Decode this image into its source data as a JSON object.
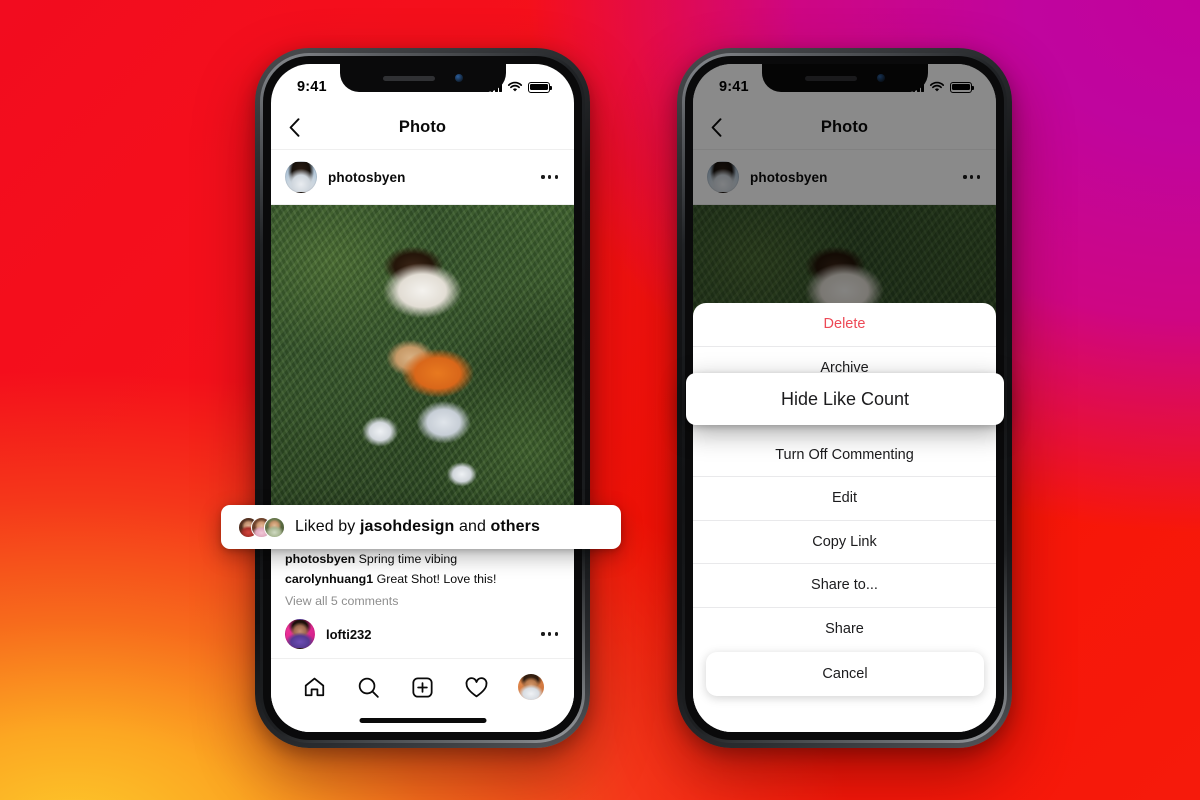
{
  "background": {
    "gradient_colors": [
      "#FDC82A",
      "#F76B1C",
      "#F20C1F",
      "#F81306",
      "#CE0683",
      "#C0059E"
    ]
  },
  "status_bar": {
    "time": "9:41"
  },
  "nav": {
    "title": "Photo",
    "back_icon": "chevron-left-icon"
  },
  "post": {
    "username": "photosbyen",
    "menu_icon": "more-options-icon",
    "actions": {
      "like_icon": "heart-icon",
      "comment_icon": "comment-bubble-icon",
      "share_icon": "share-paper-plane-icon",
      "save_icon": "bookmark-icon"
    },
    "caption": {
      "username": "photosbyen",
      "text": "Spring time vibing"
    },
    "comment": {
      "username": "carolynhuang1",
      "text": "Great Shot! Love this!"
    },
    "view_all_comments": "View all 5 comments",
    "comment_row": {
      "username": "lofti232",
      "menu_icon": "more-options-icon"
    }
  },
  "liked_card": {
    "prefix": "Liked by ",
    "username": "jasohdesign",
    "middle": " and ",
    "suffix": "others"
  },
  "tabbar": {
    "items": [
      {
        "icon": "home-icon",
        "label": "Home"
      },
      {
        "icon": "search-icon",
        "label": "Search"
      },
      {
        "icon": "add-post-icon",
        "label": "Create"
      },
      {
        "icon": "heart-icon",
        "label": "Activity"
      },
      {
        "icon": "profile-avatar-icon",
        "label": "Profile"
      }
    ]
  },
  "action_sheet": {
    "items": [
      {
        "label": "Delete",
        "style": "destructive"
      },
      {
        "label": "Archive",
        "style": "default"
      },
      {
        "label": "Hide Like Count",
        "style": "highlighted"
      },
      {
        "label": "Turn Off Commenting",
        "style": "default"
      },
      {
        "label": "Edit",
        "style": "default"
      },
      {
        "label": "Copy Link",
        "style": "default"
      },
      {
        "label": "Share to...",
        "style": "default"
      },
      {
        "label": "Share",
        "style": "default"
      }
    ],
    "cancel_label": "Cancel",
    "highlighted_label": "Hide Like Count",
    "destructive_color": "#ED4956"
  }
}
